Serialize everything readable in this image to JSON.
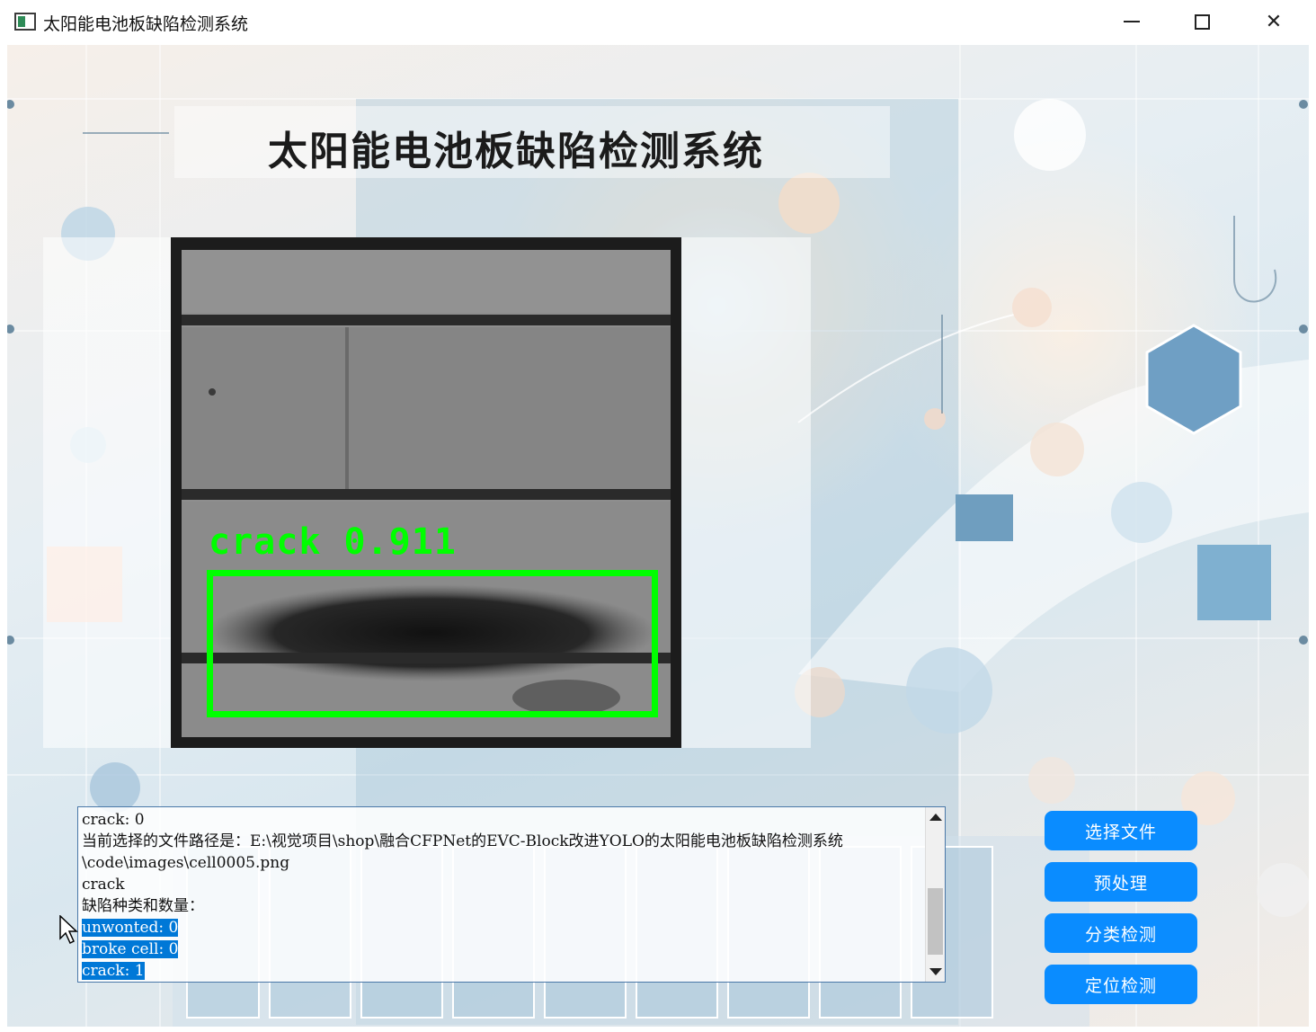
{
  "window": {
    "title": "太阳能电池板缺陷检测系统"
  },
  "header": {
    "title": "太阳能电池板缺陷检测系统"
  },
  "detection": {
    "label": "crack 0.911"
  },
  "log": {
    "lines": [
      "crack: 0",
      "当前选择的文件路径是：E:\\视觉项目\\shop\\融合CFPNet的EVC-Block改进YOLO的太阳能电池板缺陷检测系统\\code\\images\\cell0005.png",
      "crack",
      "缺陷种类和数量：",
      "unwonted: 0",
      "broke cell: 0",
      "crack: 1"
    ]
  },
  "buttons": {
    "select_file": "选择文件",
    "preprocess": "预处理",
    "classify": "分类检测",
    "locate": "定位检测"
  },
  "colors": {
    "accent": "#0a8cff",
    "detection_box": "#00ff00",
    "selection": "#0078d7"
  }
}
